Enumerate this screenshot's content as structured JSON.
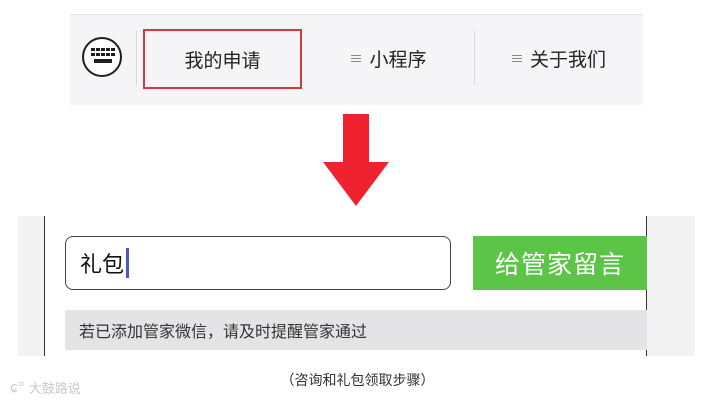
{
  "menu": {
    "items": [
      {
        "label": "我的申请",
        "highlighted": true
      },
      {
        "label": "小程序",
        "icon": "hamburger-icon"
      },
      {
        "label": "关于我们",
        "icon": "hamburger-icon"
      }
    ],
    "keyboard_icon": "keyboard-icon"
  },
  "arrow": {
    "icon": "down-arrow-icon",
    "color": "#f0222f"
  },
  "form": {
    "input_value": "礼包",
    "submit_label": "给管家留言",
    "notice": "若已添加管家微信，请及时提醒管家通过",
    "button_color": "#5cc547"
  },
  "caption": "（咨询和礼包领取步骤）",
  "watermark": "大鼓路说",
  "highlight_color": "#d33a3e"
}
